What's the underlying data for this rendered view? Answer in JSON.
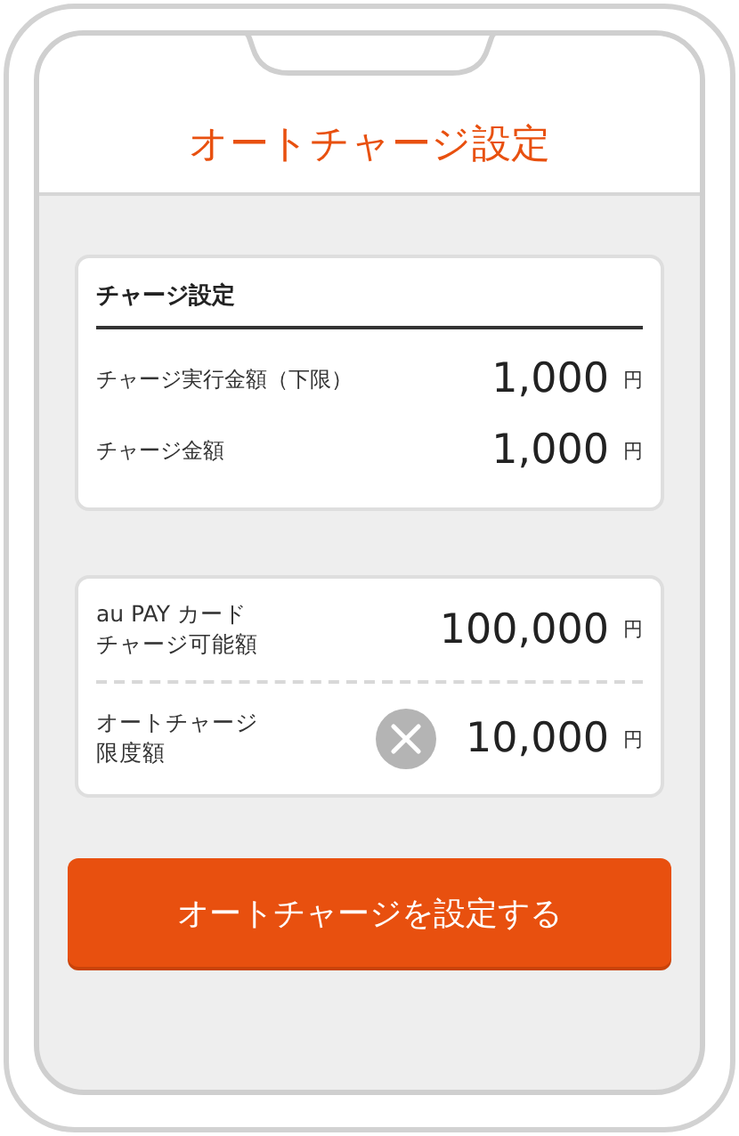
{
  "header": {
    "title": "オートチャージ設定"
  },
  "settings_card": {
    "heading": "チャージ設定",
    "rows": [
      {
        "label": "チャージ実行金額（下限）",
        "amount": "1,000",
        "unit": "円"
      },
      {
        "label": "チャージ金額",
        "amount": "1,000",
        "unit": "円"
      }
    ]
  },
  "limits_card": {
    "rows": [
      {
        "kind": "plain",
        "label_lines": [
          "au PAY カード",
          "チャージ可能額"
        ],
        "amount": "100,000",
        "unit": "円"
      },
      {
        "kind": "clearable",
        "label_lines": [
          "オートチャージ",
          "限度額"
        ],
        "amount": "10,000",
        "unit": "円"
      }
    ]
  },
  "submit_button": {
    "label": "オートチャージを設定する"
  }
}
